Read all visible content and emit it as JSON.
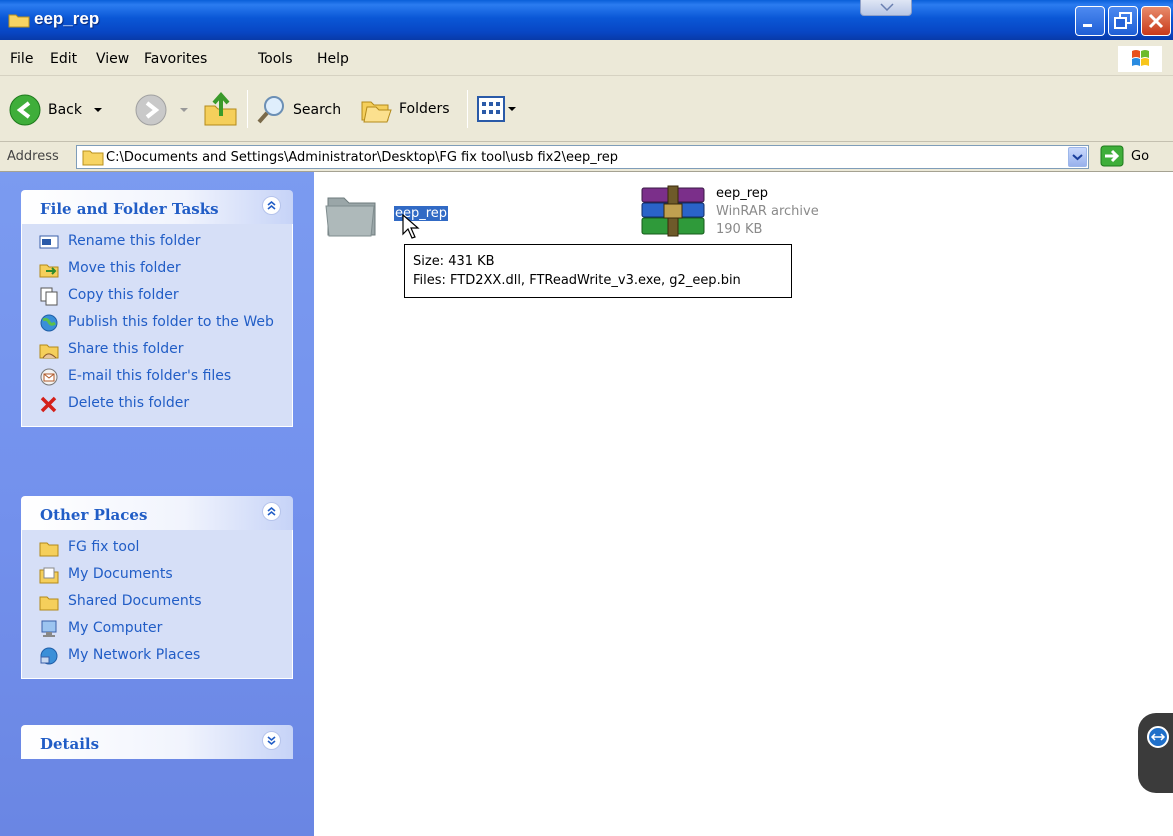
{
  "window": {
    "title": "eep_rep"
  },
  "menu": [
    "File",
    "Edit",
    "View",
    "Favorites",
    "Tools",
    "Help"
  ],
  "toolbar": {
    "back_label": "Back",
    "search_label": "Search",
    "folders_label": "Folders"
  },
  "address": {
    "label": "Address",
    "path": "C:\\Documents and Settings\\Administrator\\Desktop\\FG fix tool\\usb fix2\\eep_rep",
    "go_label": "Go"
  },
  "tasks_panel": {
    "title": "File and Folder Tasks",
    "items": [
      {
        "label": "Rename this folder",
        "icon": "rename-icon"
      },
      {
        "label": "Move this folder",
        "icon": "move-icon"
      },
      {
        "label": "Copy this folder",
        "icon": "copy-icon"
      },
      {
        "label": "Publish this folder to the Web",
        "icon": "publish-web-icon"
      },
      {
        "label": "Share this folder",
        "icon": "share-icon"
      },
      {
        "label": "E-mail this folder's files",
        "icon": "email-icon"
      },
      {
        "label": "Delete this folder",
        "icon": "delete-icon"
      }
    ]
  },
  "places_panel": {
    "title": "Other Places",
    "items": [
      {
        "label": "FG fix tool",
        "icon": "folder-icon"
      },
      {
        "label": "My Documents",
        "icon": "my-documents-icon"
      },
      {
        "label": "Shared Documents",
        "icon": "folder-icon"
      },
      {
        "label": "My Computer",
        "icon": "my-computer-icon"
      },
      {
        "label": "My Network Places",
        "icon": "network-places-icon"
      }
    ]
  },
  "details_panel": {
    "title": "Details"
  },
  "files": [
    {
      "name": "eep_rep",
      "type_label": "",
      "size": ""
    },
    {
      "name": "eep_rep",
      "type_label": "WinRAR archive",
      "size": "190 KB"
    }
  ],
  "tooltip": {
    "size_line": "Size: 431 KB",
    "files_line": "Files: FTD2XX.dll, FTReadWrite_v3.exe, g2_eep.bin"
  },
  "colors": {
    "titlebar": "#0a57d6",
    "taskpane": "#7391ed",
    "link": "#215dc6",
    "selection": "#316ac5"
  }
}
